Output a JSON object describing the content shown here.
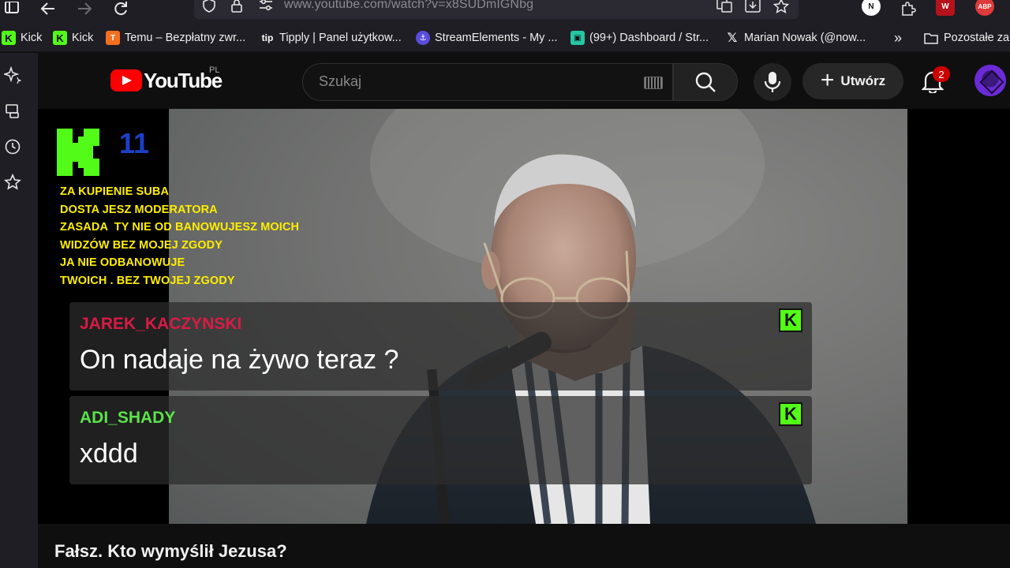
{
  "browser": {
    "url": "www.youtube.com/watch?v=x8SUDmIGNbg",
    "extensions": [
      {
        "label": "N",
        "color": "#ffffff"
      },
      {
        "label": "ABP",
        "color": "#e03a3a"
      }
    ],
    "bookmarks": [
      {
        "label": "Kick",
        "icon": "kick-icon"
      },
      {
        "label": "Kick",
        "icon": "kick-icon"
      },
      {
        "label": "Temu – Bezpłatny zwr...",
        "icon": "temu-icon"
      },
      {
        "label": "Tipply | Panel użytkow...",
        "icon": "tipply-icon"
      },
      {
        "label": "StreamElements - My ...",
        "icon": "streamelements-icon"
      },
      {
        "label": "(99+) Dashboard / Str...",
        "icon": "dashboard-icon"
      },
      {
        "label": "Marian Nowak (@now...",
        "icon": "x-icon"
      }
    ],
    "other_bookmarks": "Pozostałe zak"
  },
  "youtube": {
    "logo_text": "YouTube",
    "region": "PL",
    "search_placeholder": "Szukaj",
    "create_label": "Utwórz",
    "notification_count": "2",
    "accent": "#ff0000"
  },
  "overlay": {
    "kick_count": "11",
    "kick_color": "#53fc18",
    "notice_text": "ZA KUPIENIE SUBA\nDOSTA JESZ MODERATORA\nZASADA  TY NIE OD BANOWUJESZ MOICH\nWIDZÓW BEZ MOJEJ ZGODY\nJA NIE ODBANOWUJE\nTWOICH . BEZ TWOJEJ ZGODY",
    "chat": [
      {
        "user": "JAREK_KACZYNSKI",
        "user_color": "#d81b46",
        "message": "On nadaje na żywo teraz ?"
      },
      {
        "user": "ADI_SHADY",
        "user_color": "#5be34a",
        "message": "xddd"
      }
    ]
  },
  "video": {
    "title": "Fałsz. Kto wymyślił Jezusa?"
  }
}
